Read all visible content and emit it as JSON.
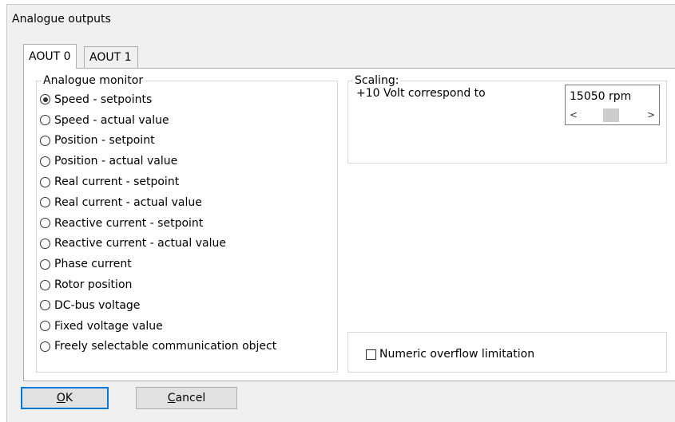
{
  "window": {
    "title": "Analogue outputs"
  },
  "tabs": [
    {
      "label": "AOUT 0",
      "active": true
    },
    {
      "label": "AOUT 1",
      "active": false
    }
  ],
  "monitor": {
    "label": "Analogue monitor",
    "selected_index": 0,
    "options": [
      "Speed - setpoints",
      "Speed - actual value",
      "Position - setpoint",
      "Position - actual value",
      "Real current - setpoint",
      "Real current - actual value",
      "Reactive current - setpoint",
      "Reactive current - actual value",
      "Phase current",
      "Rotor position",
      "DC-bus voltage",
      "Fixed voltage value",
      "Freely selectable communication object"
    ]
  },
  "scaling": {
    "label": "Scaling:",
    "text": "+10 Volt correspond to",
    "value": "15050 rpm",
    "scroll_left_icon": "<",
    "scroll_right_icon": ">"
  },
  "overflow": {
    "label": "Numeric overflow limitation",
    "checked": false
  },
  "buttons": {
    "ok_mnemonic": "O",
    "ok_rest": "K",
    "cancel_mnemonic": "C",
    "cancel_rest": "ancel"
  }
}
